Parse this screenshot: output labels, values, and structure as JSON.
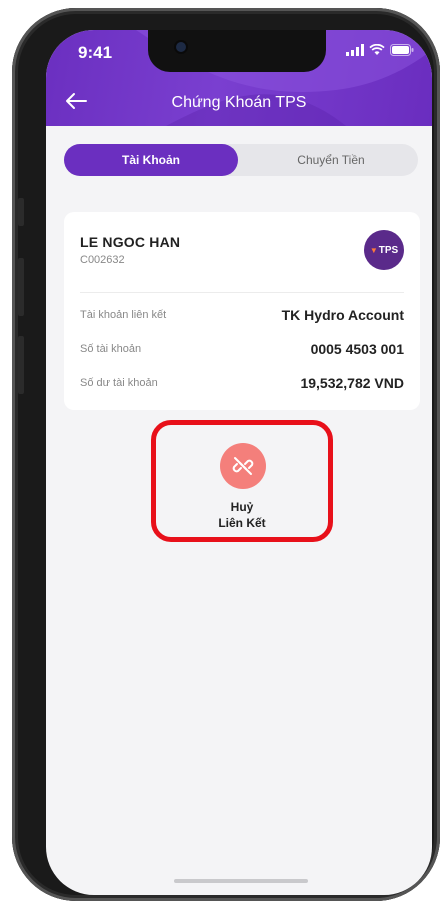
{
  "status_bar": {
    "time": "9:41"
  },
  "header": {
    "title": "Chứng Khoán TPS"
  },
  "tabs": [
    {
      "label": "Tài Khoản",
      "active": true
    },
    {
      "label": "Chuyển Tiền",
      "active": false
    }
  ],
  "account": {
    "name": "LE NGOC HAN",
    "code": "C002632",
    "logo_text": "TPS",
    "rows": [
      {
        "label": "Tài khoản liên kết",
        "value": "TK Hydro Account"
      },
      {
        "label": "Số tài khoản",
        "value": "0005 4503 001"
      },
      {
        "label": "Số dư tài khoản",
        "value": "19,532,782 VND"
      }
    ]
  },
  "unlink": {
    "line1": "Huỷ",
    "line2": "Liên Kết"
  },
  "colors": {
    "brand_purple": "#6b2fc0",
    "unlink_red": "#f47f7b",
    "highlight_red": "#e8101a"
  }
}
